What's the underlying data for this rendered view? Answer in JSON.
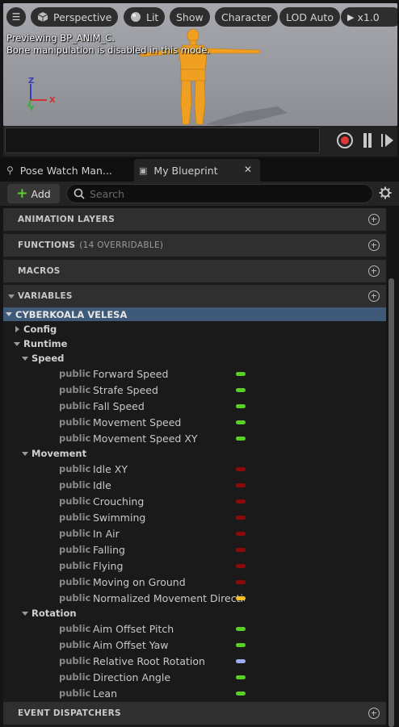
{
  "viewport": {
    "perspective": "Perspective",
    "lit": "Lit",
    "show": "Show",
    "character": "Character",
    "lod": "LOD Auto",
    "speed": "x1.0",
    "preview_msg": "Previewing BP_ANIM_C.",
    "bone_msg": "Bone manipulation is disabled in this mode.",
    "axis_z": "Z",
    "axis_x": "X",
    "axis_y": "Y"
  },
  "tabs": [
    {
      "label": "Pose Watch Man..."
    },
    {
      "label": "My Blueprint"
    }
  ],
  "toolbar": {
    "add_label": "Add",
    "search_placeholder": "Search"
  },
  "sections": {
    "animation_layers": "ANIMATION LAYERS",
    "functions": "FUNCTIONS",
    "functions_sub": "(14 OVERRIDABLE)",
    "macros": "MACROS",
    "variables": "VARIABLES",
    "event_dispatchers": "EVENT DISPATCHERS"
  },
  "blueprint_name": "CYBERKOALA VELESA",
  "categories": {
    "config": "Config",
    "runtime": "Runtime",
    "speed": "Speed",
    "movement": "Movement",
    "rotation": "Rotation"
  },
  "colors": {
    "float": "#5bd02a",
    "bool": "#8c0a0a",
    "vector": "#f5c02a",
    "rotator": "#a0acf0"
  },
  "speed_vars": [
    {
      "scope": "public",
      "name": "Forward Speed",
      "type": "float"
    },
    {
      "scope": "public",
      "name": "Strafe Speed",
      "type": "float"
    },
    {
      "scope": "public",
      "name": "Fall Speed",
      "type": "float"
    },
    {
      "scope": "public",
      "name": "Movement Speed",
      "type": "float"
    },
    {
      "scope": "public",
      "name": "Movement Speed XY",
      "type": "float"
    }
  ],
  "movement_vars": [
    {
      "scope": "public",
      "name": "Idle XY",
      "type": "bool"
    },
    {
      "scope": "public",
      "name": "Idle",
      "type": "bool"
    },
    {
      "scope": "public",
      "name": "Crouching",
      "type": "bool"
    },
    {
      "scope": "public",
      "name": "Swimming",
      "type": "bool"
    },
    {
      "scope": "public",
      "name": "In Air",
      "type": "bool"
    },
    {
      "scope": "public",
      "name": "Falling",
      "type": "bool"
    },
    {
      "scope": "public",
      "name": "Flying",
      "type": "bool"
    },
    {
      "scope": "public",
      "name": "Moving on Ground",
      "type": "bool"
    },
    {
      "scope": "public",
      "name": "Normalized Movement Direction",
      "type": "vector"
    }
  ],
  "rotation_vars": [
    {
      "scope": "public",
      "name": "Aim Offset Pitch",
      "type": "float"
    },
    {
      "scope": "public",
      "name": "Aim Offset Yaw",
      "type": "float"
    },
    {
      "scope": "public",
      "name": "Relative Root Rotation",
      "type": "rotator"
    },
    {
      "scope": "public",
      "name": "Direction Angle",
      "type": "float"
    },
    {
      "scope": "public",
      "name": "Lean",
      "type": "float"
    }
  ]
}
